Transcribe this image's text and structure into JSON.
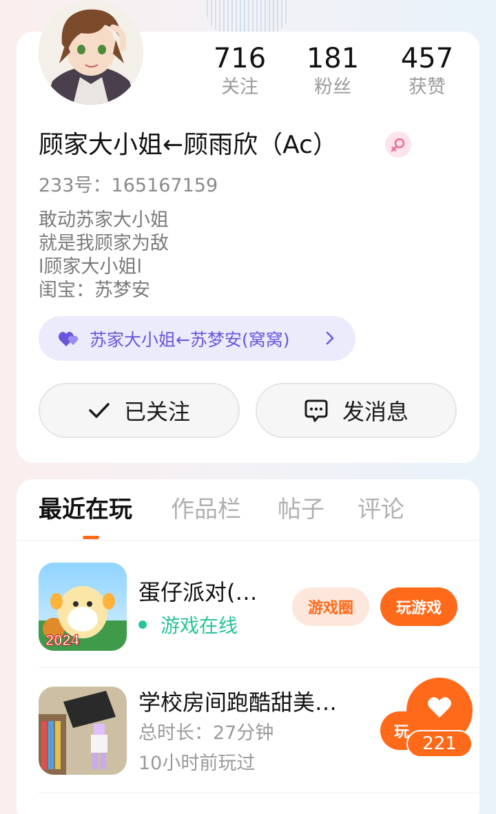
{
  "profile": {
    "display_name": "顾家大小姐←顾雨欣（Ac）",
    "uid": "233号：165167159",
    "bio_lines": [
      "敢动苏家大小姐",
      "就是我顾家为敌",
      "l顾家大小姐l",
      "闺宝：苏梦安"
    ],
    "relation_label": "苏家大小姐←苏梦安(窝窝)",
    "gender_icon": "female-icon"
  },
  "stats": [
    {
      "value": "716",
      "label": "关注"
    },
    {
      "value": "181",
      "label": "粉丝"
    },
    {
      "value": "457",
      "label": "获赞"
    }
  ],
  "actions": {
    "follow_label": "已关注",
    "message_label": "发消息"
  },
  "tabs": [
    "最近在玩",
    "作品栏",
    "帖子",
    "评论"
  ],
  "active_tab": "最近在玩",
  "games": [
    {
      "title": "蛋仔派对(…",
      "status": "游戏在线",
      "circle_label": "游戏圈",
      "play_label": "玩游戏",
      "thumb_badge": "2024"
    },
    {
      "title": "学校房间跑酷甜美…",
      "duration": "总时长：27分钟",
      "last_played": "10小时前玩过",
      "play_label_partial": "玩"
    }
  ],
  "like_fab": {
    "count": "221"
  },
  "colors": {
    "accent": "#ff6a1a",
    "online": "#28c39a",
    "relation": "#6a56d8"
  }
}
